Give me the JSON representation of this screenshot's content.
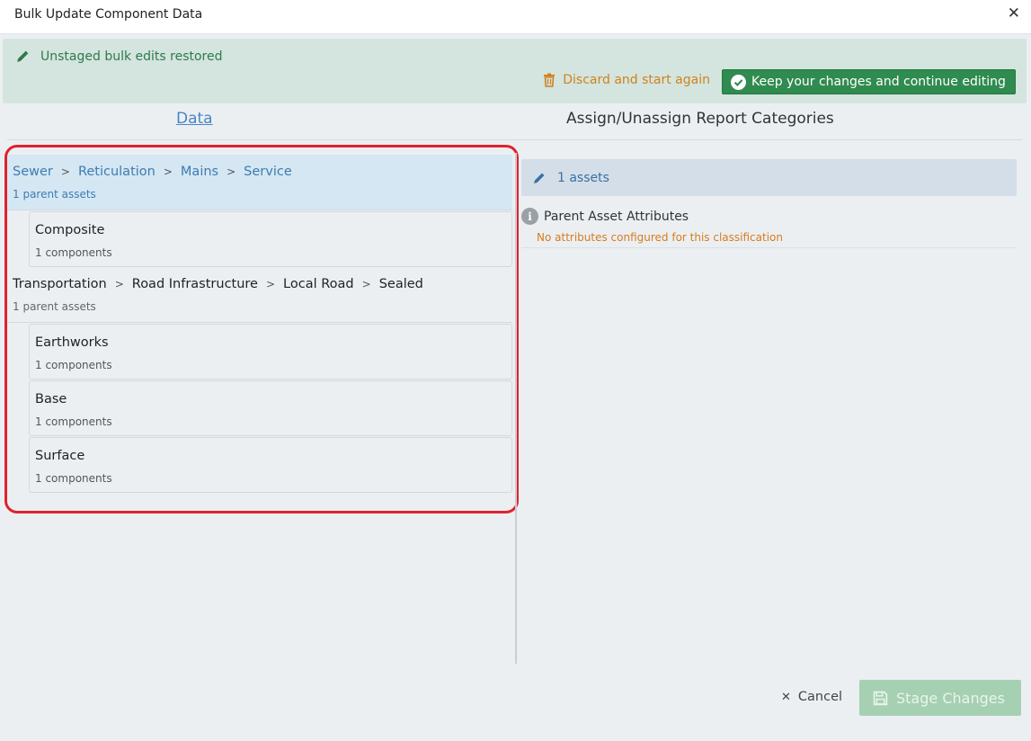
{
  "dialog": {
    "title": "Bulk Update Component Data",
    "close_icon": "close-icon"
  },
  "banner": {
    "message": "Unstaged bulk edits restored",
    "discard_label": "Discard and start again",
    "keep_label": "Keep your changes and continue editing",
    "colors": {
      "background": "#d3e5de",
      "message": "#2f7a4a",
      "discard": "#d0821e",
      "keep": "#2f8b4f"
    }
  },
  "tabs": {
    "data": "Data",
    "assign": "Assign/Unassign Report Categories"
  },
  "groups": [
    {
      "path": [
        "Sewer",
        "Reticulation",
        "Mains",
        "Service"
      ],
      "parent_count": "1 parent assets",
      "selected": true,
      "components": [
        {
          "name": "Composite",
          "count": "1 components"
        }
      ]
    },
    {
      "path": [
        "Transportation",
        "Road Infrastructure",
        "Local Road",
        "Sealed"
      ],
      "parent_count": "1 parent assets",
      "selected": false,
      "components": [
        {
          "name": "Earthworks",
          "count": "1 components"
        },
        {
          "name": "Base",
          "count": "1 components"
        },
        {
          "name": "Surface",
          "count": "1 components"
        }
      ]
    }
  ],
  "path_separator": ">",
  "right_panel": {
    "assets_label": "1 assets",
    "attributes_title": "Parent Asset Attributes",
    "info_icon_glyph": "i",
    "no_attributes": "No attributes configured for this classification"
  },
  "footer": {
    "cancel_label": "Cancel",
    "stage_label": "Stage Changes"
  }
}
